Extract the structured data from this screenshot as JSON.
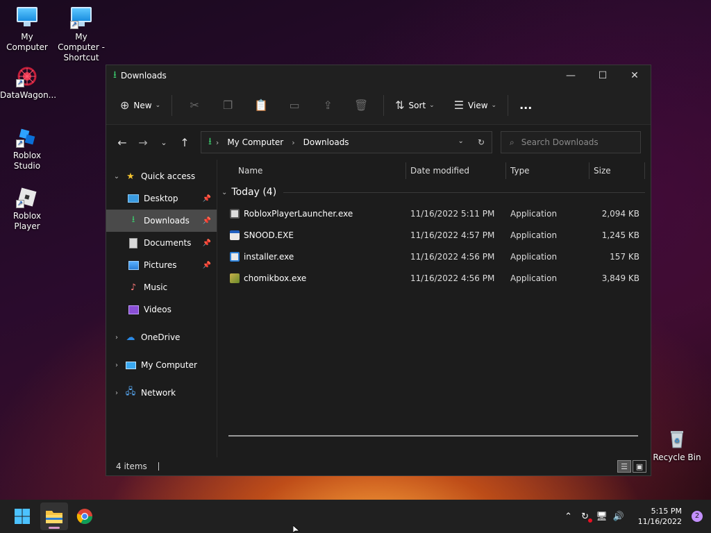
{
  "desktop": {
    "icons": [
      {
        "label": "My Computer"
      },
      {
        "label": "My Computer - Shortcut"
      },
      {
        "label": "DataWagon..."
      },
      {
        "label": "Roblox Studio"
      },
      {
        "label": "Roblox Player"
      },
      {
        "label": "Recycle Bin"
      }
    ]
  },
  "window": {
    "title": "Downloads",
    "toolbar": {
      "new_label": "New",
      "sort_label": "Sort",
      "view_label": "View",
      "more_label": "..."
    },
    "address": {
      "segments": [
        "My Computer",
        "Downloads"
      ]
    },
    "search": {
      "placeholder": "Search Downloads"
    },
    "nav": {
      "quick_access": "Quick access",
      "items": [
        {
          "label": "Desktop"
        },
        {
          "label": "Downloads"
        },
        {
          "label": "Documents"
        },
        {
          "label": "Pictures"
        },
        {
          "label": "Music"
        },
        {
          "label": "Videos"
        }
      ],
      "onedrive": "OneDrive",
      "my_computer": "My Computer",
      "network": "Network"
    },
    "columns": {
      "name": "Name",
      "date": "Date modified",
      "type": "Type",
      "size": "Size"
    },
    "group": {
      "label": "Today (4)"
    },
    "files": [
      {
        "name": "RobloxPlayerLauncher.exe",
        "date": "11/16/2022 5:11 PM",
        "type": "Application",
        "size": "2,094 KB"
      },
      {
        "name": "SNOOD.EXE",
        "date": "11/16/2022 4:57 PM",
        "type": "Application",
        "size": "1,245 KB"
      },
      {
        "name": "installer.exe",
        "date": "11/16/2022 4:56 PM",
        "type": "Application",
        "size": "157 KB"
      },
      {
        "name": "chomikbox.exe",
        "date": "11/16/2022 4:56 PM",
        "type": "Application",
        "size": "3,849 KB"
      }
    ],
    "status": {
      "count": "4 items"
    }
  },
  "taskbar": {
    "time": "5:15 PM",
    "date": "11/16/2022",
    "notification_count": "2"
  }
}
